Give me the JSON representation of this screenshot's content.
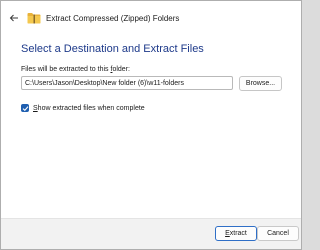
{
  "window": {
    "title": "Extract Compressed (Zipped) Folders",
    "icons": {
      "back": "back-arrow-icon",
      "folder": "zip-folder-icon"
    }
  },
  "heading": "Select a Destination and Extract Files",
  "destination": {
    "label_pre": "Files will be extracted to this ",
    "label_accel": "f",
    "label_post": "older:",
    "value": "C:\\Users\\Jason\\Desktop\\New folder (6)\\w11-folders",
    "browse_label": "Browse..."
  },
  "show_files": {
    "checked": true,
    "label_accel": "S",
    "label_rest": "how extracted files when complete"
  },
  "footer": {
    "extract_accel": "E",
    "extract_rest": "xtract",
    "cancel_label": "Cancel"
  },
  "colors": {
    "heading": "#1e3a8a",
    "accent": "#1f5fb0",
    "folder": "#e8b23a"
  }
}
